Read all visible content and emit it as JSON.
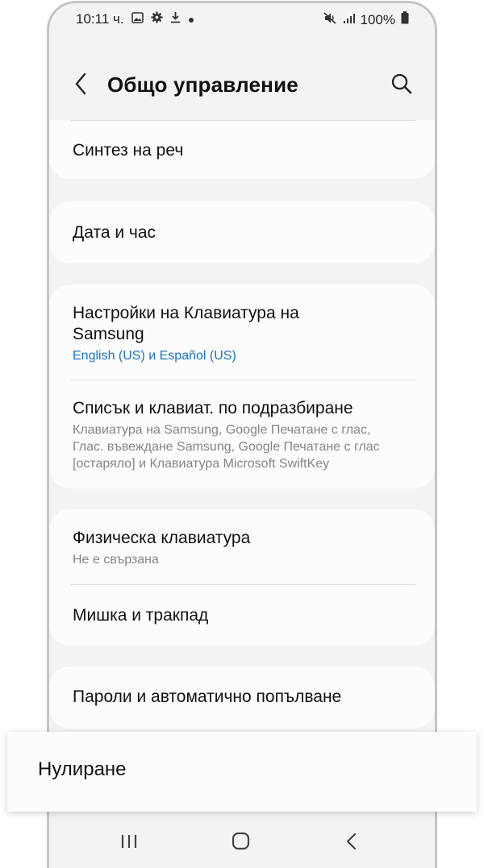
{
  "status_bar": {
    "time": "10:11 ч.",
    "battery": "100%",
    "icons": [
      "image-icon",
      "gear-icon",
      "download-icon",
      "dot-icon",
      "mute-icon",
      "signal-icon",
      "battery-icon"
    ]
  },
  "header": {
    "title": "Общо управление",
    "icons": [
      "back-arrow-icon",
      "search-icon"
    ]
  },
  "sections": [
    {
      "items": [
        {
          "title": "Синтез на реч"
        }
      ]
    },
    {
      "items": [
        {
          "title": "Дата и час"
        }
      ]
    },
    {
      "items": [
        {
          "title_line1": "Настройки на Клавиатура на",
          "title_line2": "Samsung",
          "subtitle": "English (US) и Español (US)"
        },
        {
          "title": "Списък и клавиат. по подразбиране",
          "subtitle_line1": "Клавиатура на Samsung, Google Печатане с глас,",
          "subtitle_line2": "Глас. въвеждане Samsung, Google Печатане с глас",
          "subtitle_line3": "[остаряло] и Клавиатура Microsoft SwiftKey"
        }
      ]
    },
    {
      "items": [
        {
          "title": "Физическа клавиатура",
          "subtitle": "Не е свързана"
        },
        {
          "title": "Мишка и тракпад"
        }
      ]
    },
    {
      "items": [
        {
          "title": "Пароли и автоматично попълване"
        }
      ]
    }
  ],
  "highlighted_item": {
    "label": "Нулиране"
  },
  "nav_bar": {
    "icons": [
      "recent-apps-icon",
      "home-icon",
      "nav-back-icon"
    ]
  },
  "colors": {
    "background": "#f3f3f3",
    "card": "#fcfcfc",
    "link_blue": "#1b73c2",
    "secondary_text": "#858585"
  }
}
